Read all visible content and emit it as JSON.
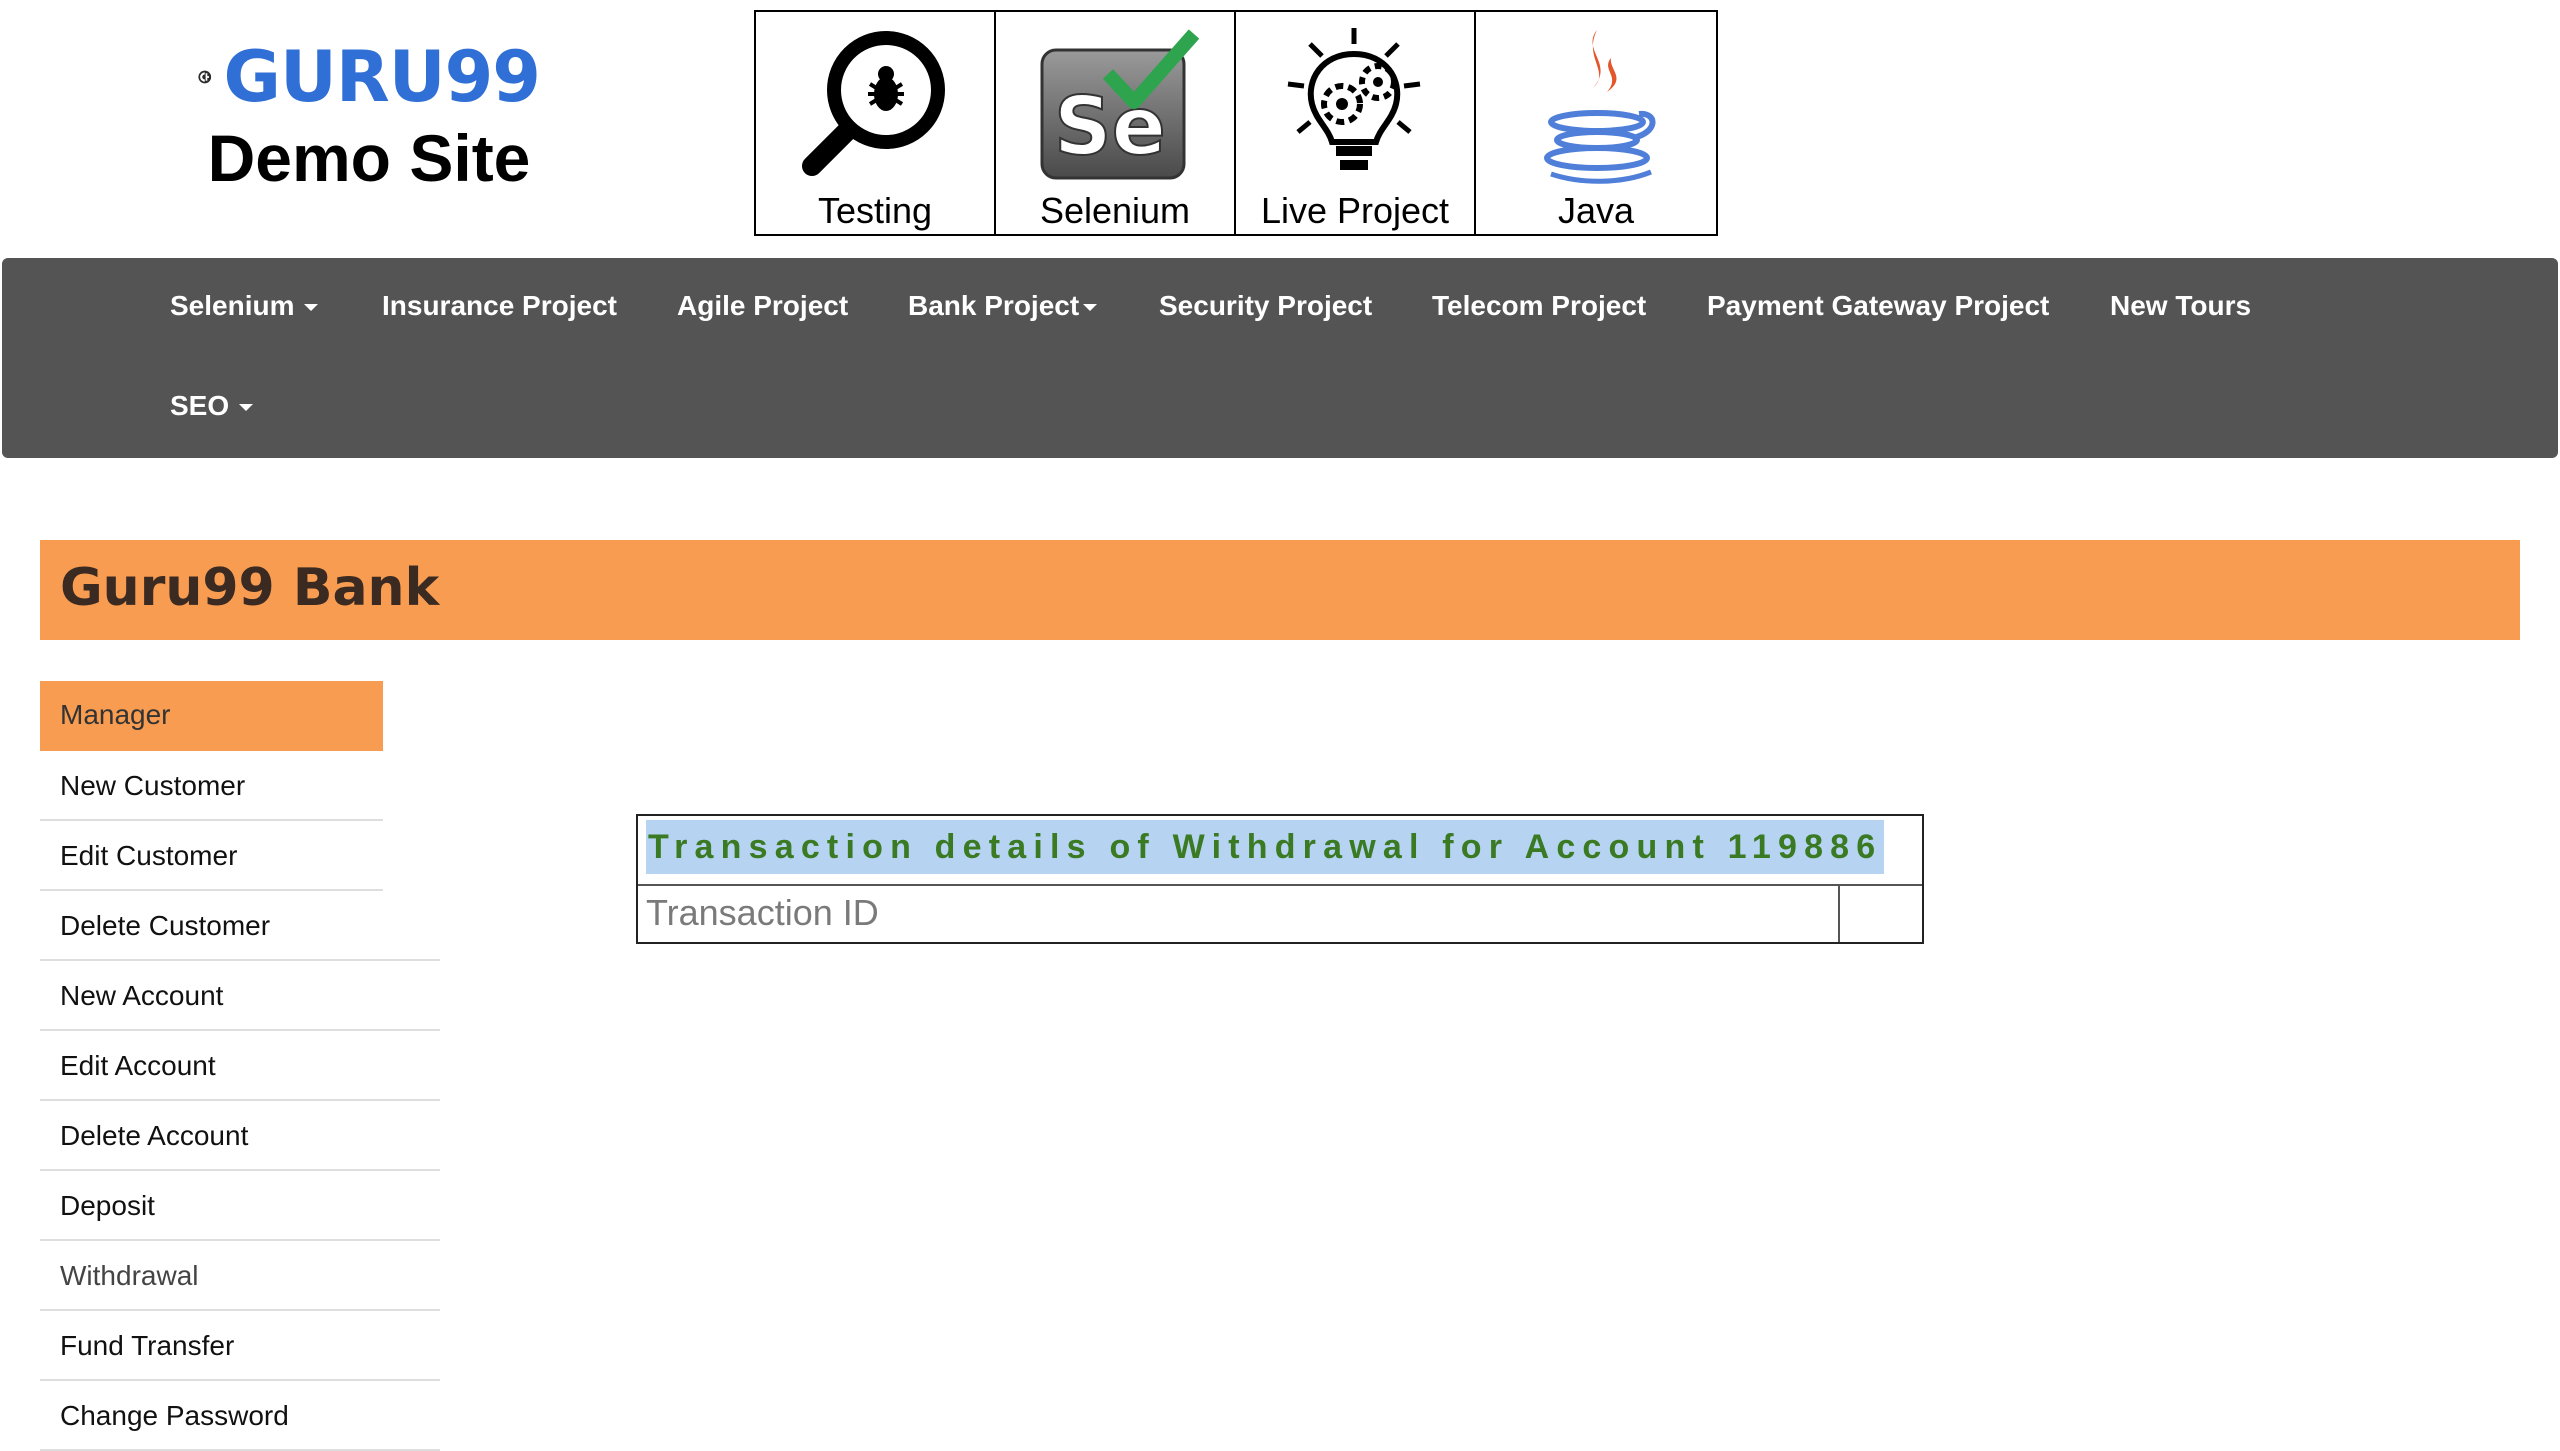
{
  "logo": {
    "brand": "GURU99",
    "subtitle": "Demo Site"
  },
  "tiles": [
    {
      "label": "Testing",
      "icon": "magnifier-bug-icon"
    },
    {
      "label": "Selenium",
      "icon": "selenium-check-icon"
    },
    {
      "label": "Live Project",
      "icon": "lightbulb-gears-icon"
    },
    {
      "label": "Java",
      "icon": "java-cup-icon"
    }
  ],
  "nav": {
    "items": [
      {
        "label": "Selenium",
        "dropdown": true
      },
      {
        "label": "Insurance Project",
        "dropdown": false
      },
      {
        "label": "Agile Project",
        "dropdown": false
      },
      {
        "label": "Bank Project",
        "dropdown": true
      },
      {
        "label": "Security Project",
        "dropdown": false
      },
      {
        "label": "Telecom Project",
        "dropdown": false
      },
      {
        "label": "Payment Gateway Project",
        "dropdown": false
      },
      {
        "label": "New Tours",
        "dropdown": false
      },
      {
        "label": "SEO",
        "dropdown": true
      }
    ]
  },
  "bank": {
    "title": "Guru99 Bank"
  },
  "sidebar": {
    "header": "Manager",
    "items": [
      "New Customer",
      "Edit Customer",
      "Delete Customer",
      "New Account",
      "Edit Account",
      "Delete Account",
      "Deposit",
      "Withdrawal",
      "Fund Transfer",
      "Change Password"
    ]
  },
  "transaction": {
    "heading": "Transaction details of Withdrawal for Account 119886",
    "id_label": "Transaction ID",
    "id_value": ""
  },
  "colors": {
    "accent_orange": "#f79c51",
    "nav_bg": "#545454",
    "heading_green": "#3a7a22",
    "heading_highlight": "#b6d3f2",
    "brand_blue": "#2f6fd6"
  }
}
